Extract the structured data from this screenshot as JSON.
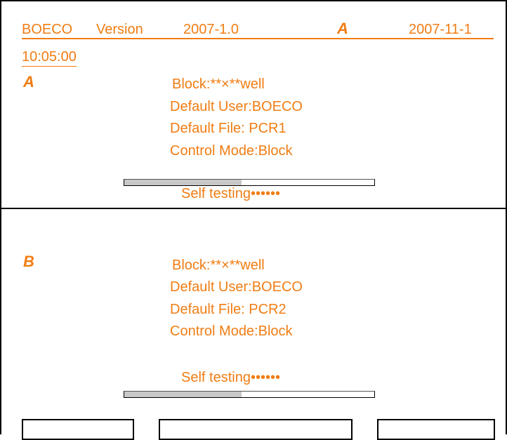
{
  "header": {
    "app_name": "BOECO",
    "version_label": "Version",
    "version": "2007-1.0",
    "date": "2007-11-1",
    "time": "10:05:00",
    "label_a": "A"
  },
  "panel_a": {
    "label": "A",
    "block": "Block:**×**well",
    "default_user": "Default User:BOECO",
    "default_file": "Default File: PCR1",
    "control_mode": "Control Mode:Block",
    "status": "Self testing••••••",
    "progress": 0.47
  },
  "panel_b": {
    "label": "B",
    "block": "Block:**×**well",
    "default_user": "Default User:BOECO",
    "default_file": "Default File: PCR2",
    "control_mode": "Control Mode:Block",
    "status": "Self testing••••••",
    "progress": 0.47
  },
  "colors": {
    "text": "#f07d14",
    "border": "#000000",
    "progress_fill": "#c8c8c8"
  }
}
